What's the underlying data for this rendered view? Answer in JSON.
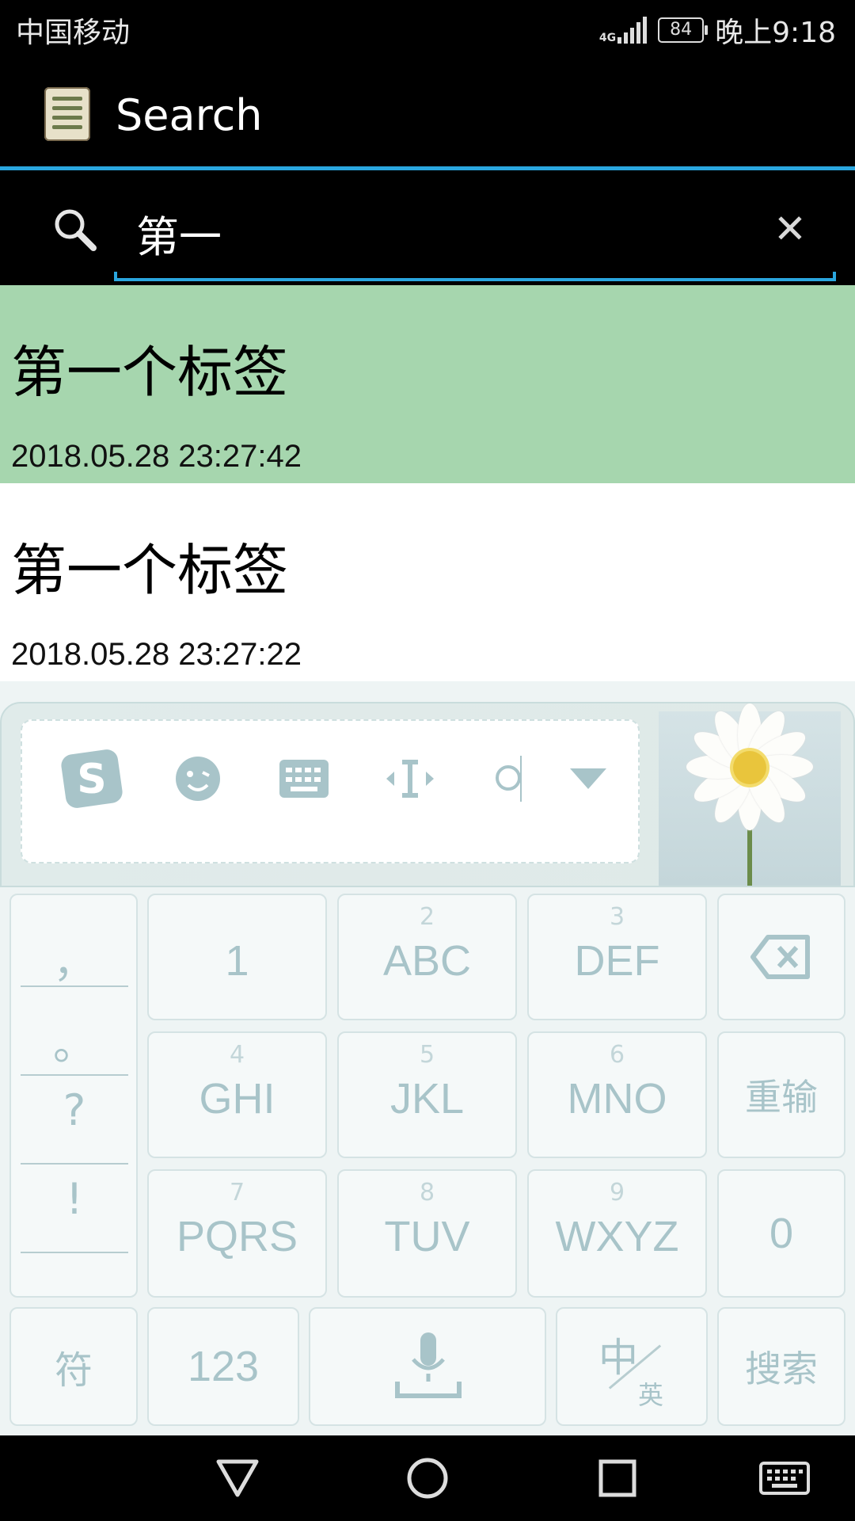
{
  "status_bar": {
    "carrier": "中国移动",
    "network": "4G",
    "battery": "84",
    "time": "晚上9:18"
  },
  "action_bar": {
    "title": "Search",
    "app_icon": "notes-app-icon"
  },
  "search": {
    "query": "第一",
    "search_icon": "search-icon",
    "clear_icon": "close-icon"
  },
  "results": [
    {
      "title": "第一个标签",
      "date": "2018.05.28 23:27:42",
      "selected": true
    },
    {
      "title": "第一个标签",
      "date": "2018.05.28 23:27:22",
      "selected": false
    }
  ],
  "keyboard": {
    "toolbar": [
      "sogou-logo-icon",
      "emoji-icon",
      "keyboard-icon",
      "cursor-move-icon",
      "search-icon",
      "collapse-icon"
    ],
    "punctuation": [
      "，",
      "。",
      "?",
      "!"
    ],
    "keys": [
      {
        "num": "",
        "label": "1"
      },
      {
        "num": "2",
        "label": "ABC"
      },
      {
        "num": "3",
        "label": "DEF"
      },
      {
        "num": "4",
        "label": "GHI"
      },
      {
        "num": "5",
        "label": "JKL"
      },
      {
        "num": "6",
        "label": "MNO"
      },
      {
        "num": "7",
        "label": "PQRS"
      },
      {
        "num": "8",
        "label": "TUV"
      },
      {
        "num": "9",
        "label": "WXYZ"
      }
    ],
    "reenter": "重输",
    "zero": "0",
    "symbols": "符",
    "numbers": "123",
    "lang_zh": "中",
    "lang_en": "英",
    "search": "搜索",
    "accent_color": "#a8c4c9"
  },
  "nav_bar": [
    "back-icon",
    "home-icon",
    "recents-icon",
    "keyboard-icon"
  ],
  "colors": {
    "selected_row": "#a6d6ae",
    "accent": "#2aa6df"
  }
}
